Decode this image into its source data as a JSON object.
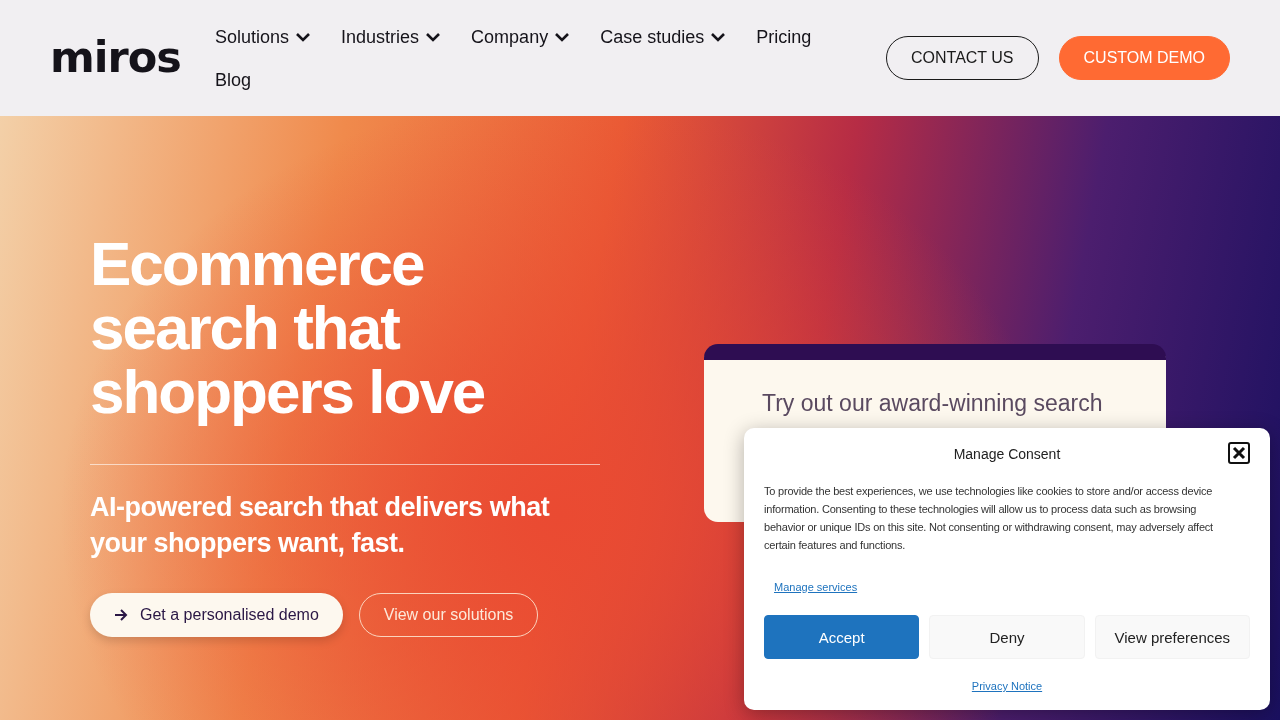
{
  "header": {
    "logo": "miros",
    "nav": [
      {
        "label": "Solutions",
        "has_menu": true
      },
      {
        "label": "Industries",
        "has_menu": true
      },
      {
        "label": "Company",
        "has_menu": true
      },
      {
        "label": "Case studies",
        "has_menu": true
      },
      {
        "label": "Pricing",
        "has_menu": false
      },
      {
        "label": "Blog",
        "has_menu": false
      }
    ],
    "buttons": [
      {
        "label": "CONTACT US",
        "kind": "outline"
      },
      {
        "label": "CUSTOM DEMO",
        "kind": "filled"
      }
    ]
  },
  "hero": {
    "title": "Ecommerce search that shoppers love",
    "subtitle": "AI-powered search that delivers what your shoppers want, fast.",
    "buttons": [
      {
        "label": "Get a personalised demo",
        "kind": "primary"
      },
      {
        "label": "View our solutions",
        "kind": "outline"
      }
    ]
  },
  "search_card": {
    "title": "Try out our award-winning search"
  },
  "consent": {
    "title": "Manage Consent",
    "text": "To provide the best experiences, we use technologies like cookies to store and/or access device information. Consenting to these technologies will allow us to process data such as browsing behavior or unique IDs on this site. Not consenting or withdrawing consent, may adversely affect certain features and functions.",
    "manage_link": "Manage services",
    "buttons": [
      {
        "label": "Accept",
        "kind": "primary"
      },
      {
        "label": "Deny",
        "kind": "secondary"
      },
      {
        "label": "View preferences",
        "kind": "secondary"
      }
    ],
    "privacy_link": "Privacy Notice"
  }
}
